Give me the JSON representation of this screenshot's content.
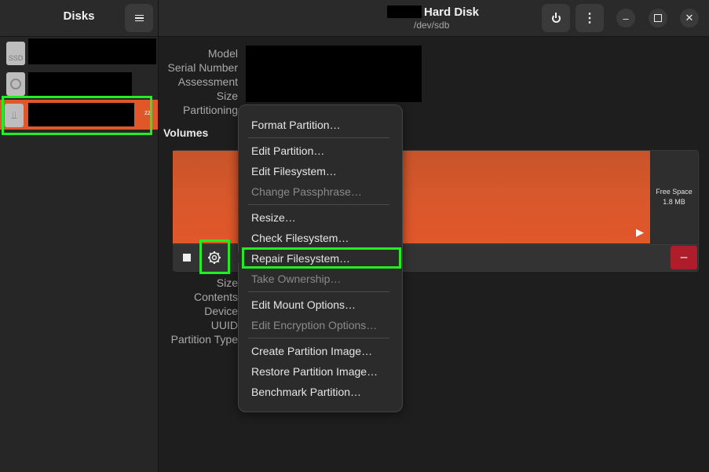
{
  "sidebar": {
    "title": "Disks",
    "menu_icon": "hamburger-menu-icon",
    "devices": [
      {
        "icon": "ssd-icon",
        "icon_text": "SSD"
      },
      {
        "icon": "optical-disc-icon"
      },
      {
        "icon": "usb-drive-icon",
        "selected": true,
        "badge": "zz"
      }
    ]
  },
  "header": {
    "title": "Hard Disk",
    "subtitle": "/dev/sdb",
    "power_icon": "power-icon",
    "more_icon": "more-vertical-icon"
  },
  "drive_info": {
    "labels": [
      "Model",
      "Serial Number",
      "Assessment",
      "Size",
      "Partitioning"
    ]
  },
  "volumes": {
    "heading": "Volumes",
    "free_space_title": "Free Space",
    "free_space_size": "1.8 MB",
    "detail_labels": [
      "Size",
      "Contents",
      "Device",
      "UUID",
      "Partition Type"
    ]
  },
  "context_menu": {
    "items": [
      {
        "label": "Format Partition…",
        "enabled": true
      },
      {
        "label": "Edit Partition…",
        "enabled": true
      },
      {
        "label": "Edit Filesystem…",
        "enabled": true
      },
      {
        "label": "Change Passphrase…",
        "enabled": false
      },
      {
        "label": "Resize…",
        "enabled": true
      },
      {
        "label": "Check Filesystem…",
        "enabled": true
      },
      {
        "label": "Repair Filesystem…",
        "enabled": true
      },
      {
        "label": "Take Ownership…",
        "enabled": false
      },
      {
        "label": "Edit Mount Options…",
        "enabled": true
      },
      {
        "label": "Edit Encryption Options…",
        "enabled": false
      },
      {
        "label": "Create Partition Image…",
        "enabled": true
      },
      {
        "label": "Restore Partition Image…",
        "enabled": true
      },
      {
        "label": "Benchmark Partition…",
        "enabled": true
      }
    ]
  },
  "colors": {
    "accent": "#e0572a",
    "highlight": "#22ee22",
    "danger": "#b01d2a"
  }
}
